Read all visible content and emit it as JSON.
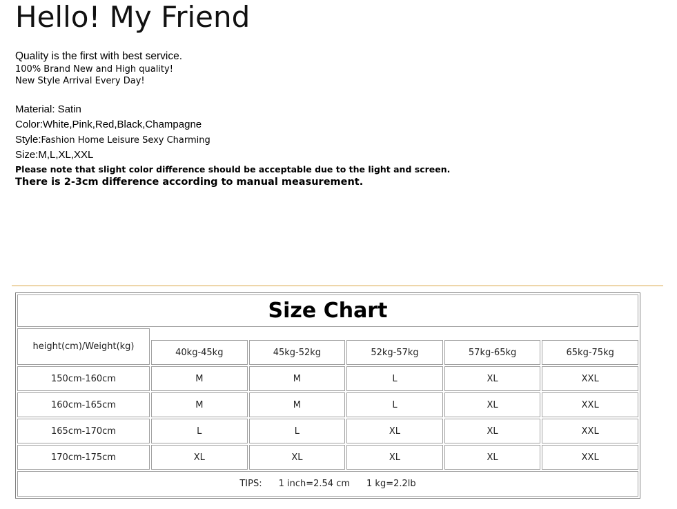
{
  "heading": "Hello! My Friend",
  "intro": {
    "quality": "Quality is the first with best service.",
    "brand": "100% Brand New and High quality!",
    "arrival": "New Style Arrival Every Day!"
  },
  "specs": {
    "material": "Material: Satin",
    "color": "Color:White,Pink,Red,Black,Champagne",
    "style_label": "Style:",
    "style_value": "Fashion Home Leisure Sexy Charming",
    "size": "Size:M,L,XL,XXL"
  },
  "notes": {
    "color_note": "Please note that slight color difference should be acceptable due to the light and screen.",
    "measure_note": "There is 2-3cm difference according to manual measurement."
  },
  "size_chart": {
    "title": "Size Chart",
    "corner_label": "height(cm)/Weight(kg)",
    "weights": [
      "40kg-45kg",
      "45kg-52kg",
      "52kg-57kg",
      "57kg-65kg",
      "65kg-75kg"
    ],
    "rows": [
      {
        "height": "150cm-160cm",
        "sizes": [
          "M",
          "M",
          "L",
          "XL",
          "XXL"
        ]
      },
      {
        "height": "160cm-165cm",
        "sizes": [
          "M",
          "M",
          "L",
          "XL",
          "XXL"
        ]
      },
      {
        "height": "165cm-170cm",
        "sizes": [
          "L",
          "L",
          "XL",
          "XL",
          "XXL"
        ]
      },
      {
        "height": "170cm-175cm",
        "sizes": [
          "XL",
          "XL",
          "XL",
          "XL",
          "XXL"
        ]
      }
    ],
    "tips_label": "TIPS:",
    "tips_inch": "1 inch=2.54 cm",
    "tips_kg": "1 kg=2.2lb"
  },
  "colors": {
    "divider": "#d9a441",
    "table_border": "#808080"
  }
}
